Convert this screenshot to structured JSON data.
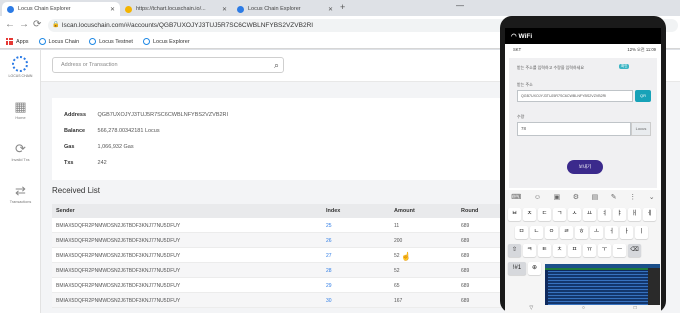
{
  "browser": {
    "tabs": [
      {
        "title": "Locus Chain Explorer",
        "color": "#2c7be5"
      },
      {
        "title": "https://tchart.locuschain.io/...",
        "color": "#f4b400"
      },
      {
        "title": "Locus Chain Explorer",
        "color": "#2c7be5"
      }
    ],
    "new_tab": "+",
    "window_controls": [
      "—",
      "☐",
      "✕"
    ],
    "address": "lscan.locuschain.com/#/accounts/QGB7UXOJYJ3TUJ5R7SC6CWBLNFYBS2VZVB2RI",
    "bookmarks": [
      "Apps",
      "Locus Chain",
      "Locus Testnet",
      "Locus Explorer"
    ]
  },
  "sidebar": {
    "logo_text": "LOCUS CHAIN",
    "items": [
      {
        "label": "Home",
        "icon": "grid-icon",
        "glyph": "▦"
      },
      {
        "label": "Invalid Txs",
        "icon": "refresh-icon",
        "glyph": "⟳"
      },
      {
        "label": "Transactions",
        "icon": "transfer-icon",
        "glyph": "⇄"
      }
    ]
  },
  "search": {
    "placeholder": "Address or Transaction"
  },
  "account": {
    "rows": [
      {
        "key": "Address",
        "value": "QGB7UXOJYJ3TUJ5R7SC6CWBLNFYBS2VZVB2RI"
      },
      {
        "key": "Balance",
        "value": "566,278.00342181 Locus"
      },
      {
        "key": "Gas",
        "value": "1,066,932 Gas"
      },
      {
        "key": "Txs",
        "value": "242"
      }
    ]
  },
  "received": {
    "title": "Received List",
    "headers": [
      "Sender",
      "Index",
      "Amount",
      "Round"
    ],
    "rows": [
      {
        "sender": "BMIAX5DQFR2PNMWDSN2J6TBDF3KNJ77NU5DFUY",
        "index": "25",
        "amount": "11",
        "round": "689"
      },
      {
        "sender": "BMIAX5DQFR2PNMWDSN2J6TBDF3KNJ77NU5DFUY",
        "index": "26",
        "amount": "200",
        "round": "689"
      },
      {
        "sender": "BMIAX5DQFR2PNMWDSN2J6TBDF3KNJ77NU5DFUY",
        "index": "27",
        "amount": "52",
        "round": "689"
      },
      {
        "sender": "BMIAX5DQFR2PNMWDSN2J6TBDF3KNJ77NU5DFUY",
        "index": "28",
        "amount": "52",
        "round": "689"
      },
      {
        "sender": "BMIAX5DQFR2PNMWDSN2J6TBDF3KNJ77NU5DFUY",
        "index": "29",
        "amount": "65",
        "round": "689"
      },
      {
        "sender": "BMIAX5DQFR2PNMWDSN2J6TBDF3KNJ77NU5DFUY",
        "index": "30",
        "amount": "167",
        "round": "689"
      }
    ]
  },
  "phone": {
    "status": "WiFi",
    "status2_left": "SKT",
    "status2_right": "12% 오전 11:09",
    "form": {
      "notice": "받는 주소를 입력하고 수량을 입력하세요",
      "tag": "확인",
      "address_label": "받는 주소",
      "address_value": "QGB7UXOJYJ3TUJ5R7SC6CWBLNFYBS2VZVB2RI",
      "scan_label": "QR",
      "amount_label": "수량",
      "amount_value": "78",
      "unit": "Locus",
      "send_label": "보내기"
    },
    "nav": [
      "▽",
      "○",
      "□"
    ]
  }
}
